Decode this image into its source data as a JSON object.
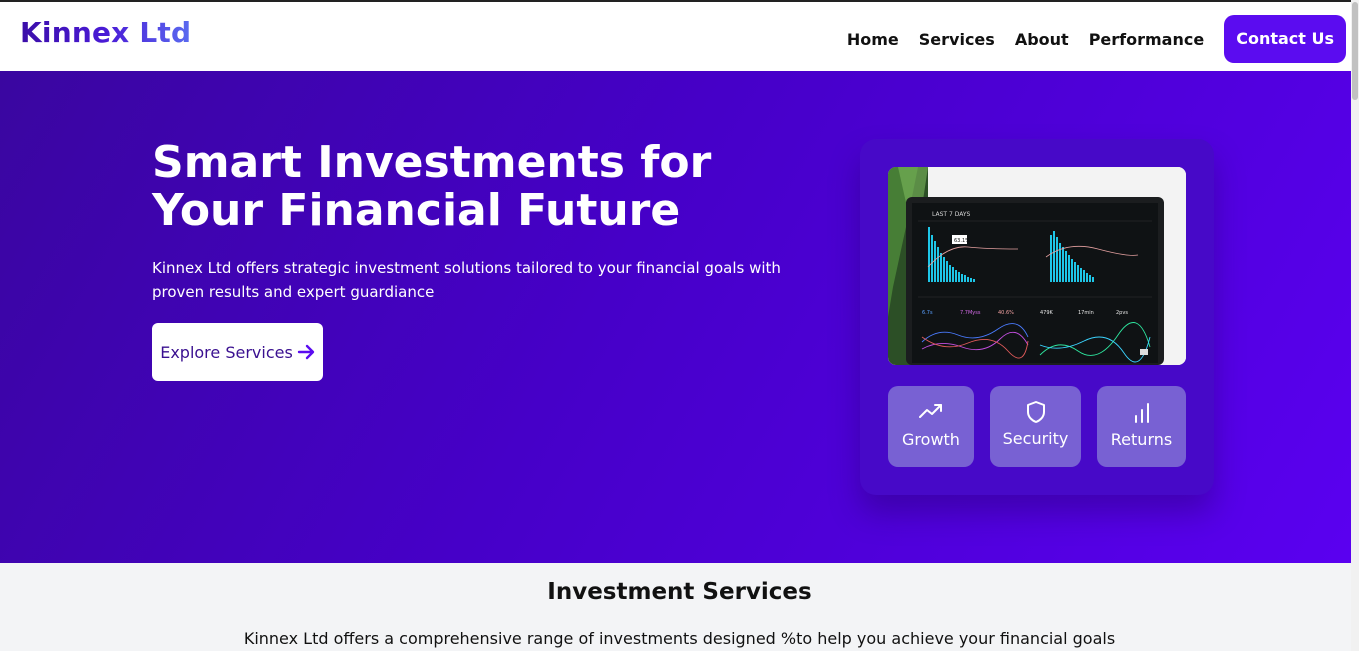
{
  "header": {
    "logo": "Kinnex Ltd",
    "nav": [
      "Home",
      "Services",
      "About",
      "Performance"
    ],
    "contact_label": "Contact Us"
  },
  "hero": {
    "title": "Smart Investments for Your Financial Future",
    "description": "Kinnex Ltd offers strategic investment solutions tailored to your financial goals with proven results and expert guardiance",
    "cta_label": "Explore Services",
    "cta_icon": "arrow-right-icon",
    "features": [
      {
        "label": "Growth",
        "icon": "trending-up-icon"
      },
      {
        "label": "Security",
        "icon": "shield-icon"
      },
      {
        "label": "Returns",
        "icon": "bar-chart-icon"
      }
    ],
    "dashboard": {
      "header": "LAST 7 DAYS",
      "stats": [
        "6.7s",
        "7.7Myss",
        "40.6%",
        "479K",
        "17min",
        "2pvs"
      ],
      "tooltip": "63.1%"
    }
  },
  "services": {
    "title": "Investment Services",
    "description": "Kinnex Ltd offers a comprehensive range of investments designed %to help you achieve your financial goals"
  },
  "colors": {
    "brand": "#5b0cf0",
    "hero_start": "#3a06a0",
    "hero_end": "#5a00f0",
    "card": "#4709c8"
  }
}
